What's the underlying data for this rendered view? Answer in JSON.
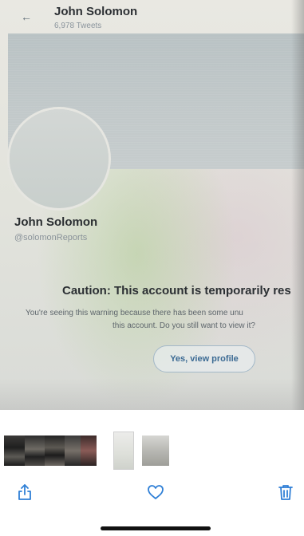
{
  "photo": {
    "header": {
      "back_icon": "back-arrow-icon",
      "name": "John Solomon",
      "tweet_count": "6,978 Tweets"
    },
    "profile": {
      "name": "John Solomon",
      "handle": "@solomonReports"
    },
    "caution": {
      "title": "Caution: This account is temporarily res",
      "line1": "You're seeing this warning because there has been some unu",
      "line2": "this account. Do you still want to view it?",
      "button_label": "Yes, view profile"
    }
  },
  "toolbar": {
    "share_icon": "share-icon",
    "favorite_icon": "heart-icon",
    "delete_icon": "trash-icon"
  },
  "colors": {
    "accent": "#2f7fd6",
    "link_button_text": "#3b6a93"
  }
}
